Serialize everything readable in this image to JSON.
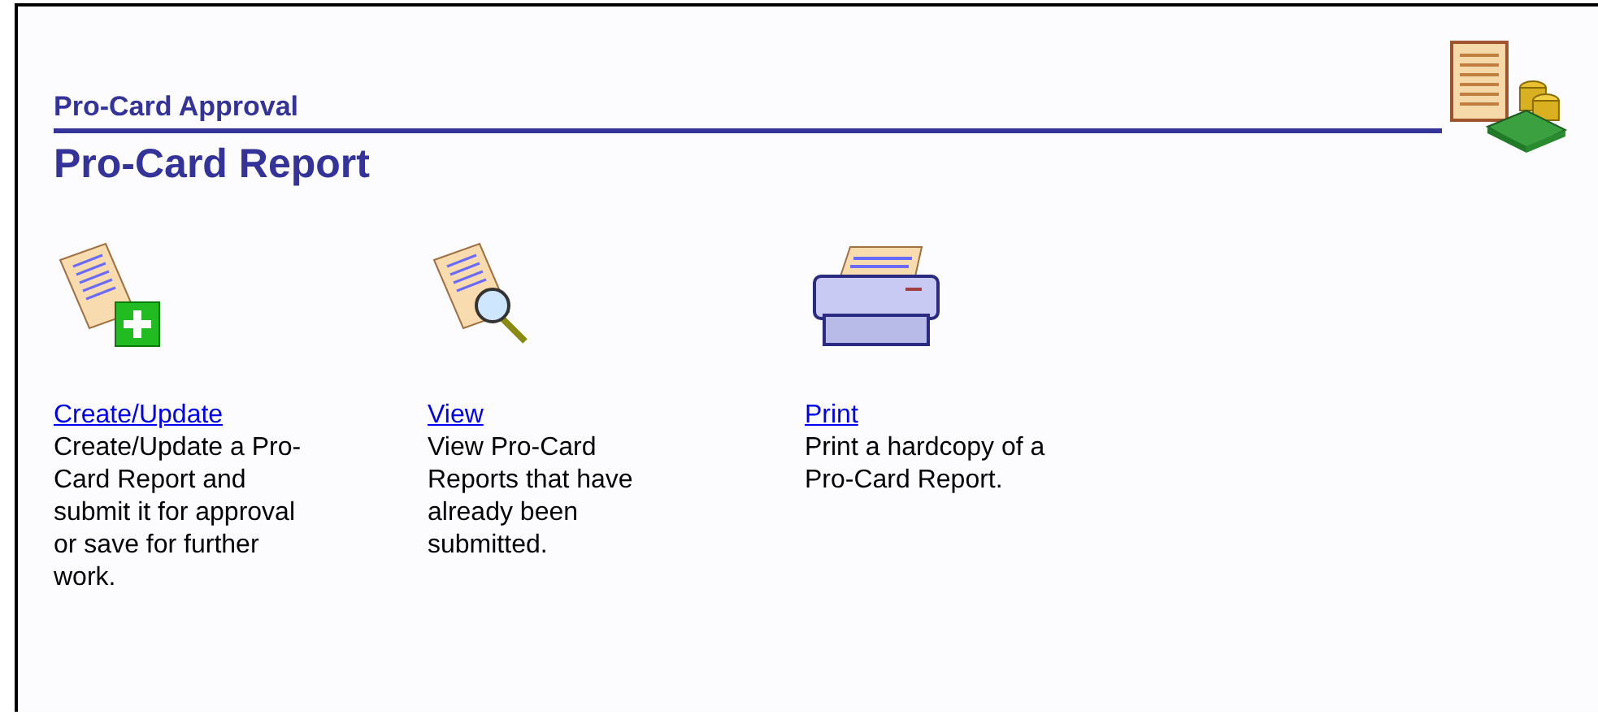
{
  "page": {
    "section_title": "Pro-Card Approval",
    "title": "Pro-Card Report"
  },
  "actions": [
    {
      "kind": "create",
      "link": "Create/Update",
      "description": "Create/Update a Pro-Card Report and submit it for approval or save for further work."
    },
    {
      "kind": "view",
      "link": "View",
      "description": "View Pro-Card Reports that have already been submitted."
    },
    {
      "kind": "print",
      "link": "Print",
      "description": "Print a hardcopy of a Pro-Card Report."
    }
  ]
}
